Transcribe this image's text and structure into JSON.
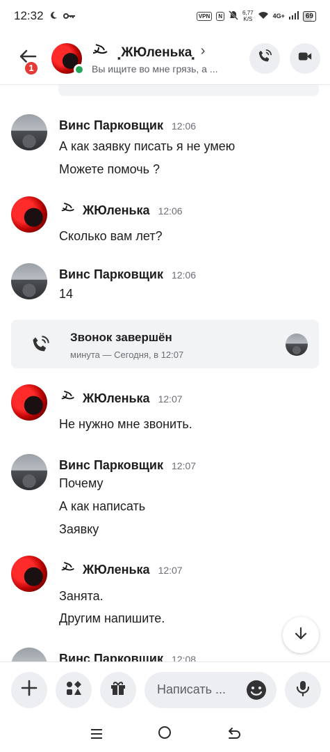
{
  "status_bar": {
    "time": "12:32",
    "moon_icon": "moon-icon",
    "key_icon": "key-icon",
    "vpn": "VPN",
    "nfc": "N",
    "speed_value": "6,77",
    "speed_unit": "K/S",
    "network": "4G+",
    "battery": "69"
  },
  "header": {
    "badge_count": "1",
    "name": "⸼ЖЮленька⸼",
    "status": "Вы ищите во мне грязь, а ..."
  },
  "names": {
    "vins": "Винс Парковщик",
    "yulenka": "ЖЮленька⸼"
  },
  "messages": [
    {
      "author": "Винс Парковщик",
      "time": "12:06",
      "lines": [
        "А как заявку писать я не умею",
        "Можете помочь ?"
      ]
    },
    {
      "author": "ЖЮленька",
      "time": "12:06",
      "lines": [
        "Сколько вам лет?"
      ]
    },
    {
      "author": "Винс Парковщик",
      "time": "12:06",
      "lines": [
        "14"
      ]
    },
    {
      "author": "ЖЮленька",
      "time": "12:07",
      "lines": [
        "Не нужно мне звонить."
      ]
    },
    {
      "author": "Винс Парковщик",
      "time": "12:07",
      "lines": [
        "Почему",
        "А как написать",
        "Заявку"
      ]
    },
    {
      "author": "ЖЮленька",
      "time": "12:07",
      "lines": [
        "Занята.",
        "Другим напишите."
      ]
    },
    {
      "author": "Винс Парковщик",
      "time": "12:08",
      "lines": []
    }
  ],
  "call": {
    "title": "Звонок завершён",
    "subtitle": "минута — Сегодня, в 12:07"
  },
  "composer": {
    "placeholder": "Написать ..."
  },
  "colors": {
    "online": "#23a55a",
    "badge": "#e53935",
    "button_bg": "#eceef1"
  }
}
